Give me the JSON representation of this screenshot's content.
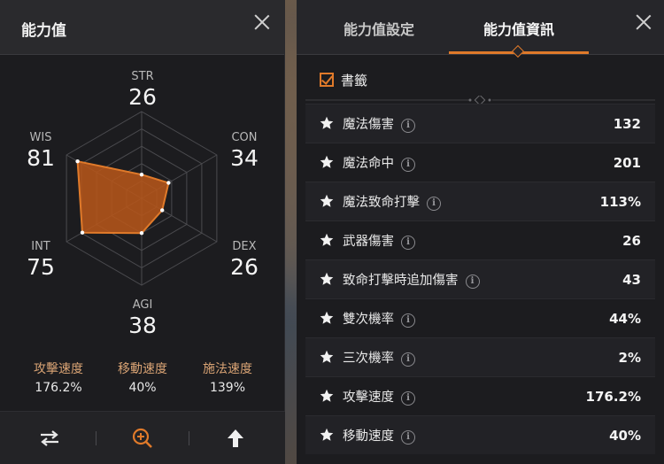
{
  "colors": {
    "accent": "#e07a2a",
    "radar_fill": "#b5551a",
    "panel_bg": "#1c1c1f",
    "speed_label": "#d9a374"
  },
  "left_panel": {
    "title": "能力值",
    "stats": {
      "str": {
        "label": "STR",
        "value": "26"
      },
      "con": {
        "label": "CON",
        "value": "34"
      },
      "dex": {
        "label": "DEX",
        "value": "26"
      },
      "agi": {
        "label": "AGI",
        "value": "38"
      },
      "int": {
        "label": "INT",
        "value": "75"
      },
      "wis": {
        "label": "WIS",
        "value": "81"
      }
    },
    "speeds": [
      {
        "label": "攻擊速度",
        "value": "176.2%"
      },
      {
        "label": "移動速度",
        "value": "40%"
      },
      {
        "label": "施法速度",
        "value": "139%"
      }
    ],
    "footer_icons": [
      "swap-arrows-icon",
      "zoom-in-icon",
      "upload-arrow-icon"
    ]
  },
  "right_panel": {
    "tabs": [
      {
        "label": "能力值設定",
        "active": false
      },
      {
        "label": "能力值資訊",
        "active": true
      }
    ],
    "bookmark": {
      "label": "書籤",
      "checked": true
    },
    "rows": [
      {
        "name": "魔法傷害",
        "value": "132"
      },
      {
        "name": "魔法命中",
        "value": "201"
      },
      {
        "name": "魔法致命打擊",
        "value": "113%"
      },
      {
        "name": "武器傷害",
        "value": "26"
      },
      {
        "name": "致命打擊時追加傷害",
        "value": "43"
      },
      {
        "name": "雙次機率",
        "value": "44%"
      },
      {
        "name": "三次機率",
        "value": "2%"
      },
      {
        "name": "攻擊速度",
        "value": "176.2%"
      },
      {
        "name": "移動速度",
        "value": "40%"
      }
    ],
    "info_glyph": "i"
  }
}
